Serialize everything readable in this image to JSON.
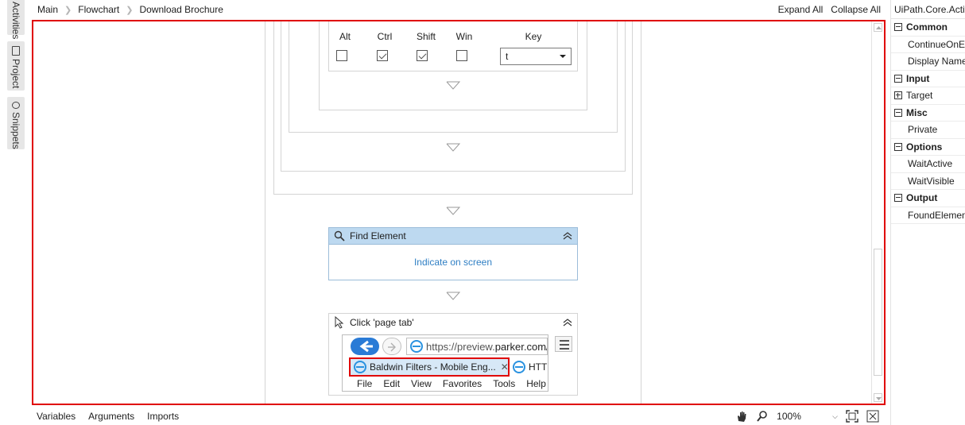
{
  "left_tabs": {
    "activities": "Activities",
    "project": "Project",
    "snippets": "Snippets"
  },
  "breadcrumb": [
    "Main",
    "Flowchart",
    "Download Brochure"
  ],
  "topbar": {
    "expand_all": "Expand All",
    "collapse_all": "Collapse All"
  },
  "modifiers": {
    "headers": [
      "Alt",
      "Ctrl",
      "Shift",
      "Win",
      "Key"
    ],
    "checked": [
      false,
      true,
      true,
      false
    ],
    "key_value": "t"
  },
  "find_element": {
    "title": "Find Element",
    "indicate": "Indicate on screen"
  },
  "click_activity": {
    "title": "Click 'page tab'",
    "browser": {
      "url_prefix": "https://preview.",
      "url_host": "parker.com/l",
      "active_tab": "Baldwin Filters - Mobile Eng...",
      "other_tab": "HTT",
      "menu": [
        "File",
        "Edit",
        "View",
        "Favorites",
        "Tools",
        "Help"
      ]
    }
  },
  "bottombar": {
    "tabs": [
      "Variables",
      "Arguments",
      "Imports"
    ],
    "zoom": "100%"
  },
  "properties": {
    "title": "UiPath.Core.Activities.FindElement",
    "rows": [
      {
        "kind": "cat",
        "label": "Common"
      },
      {
        "kind": "item",
        "label": "ContinueOnError"
      },
      {
        "kind": "item",
        "label": "Display Name"
      },
      {
        "kind": "cat",
        "label": "Input"
      },
      {
        "kind": "expand",
        "label": "Target"
      },
      {
        "kind": "cat",
        "label": "Misc"
      },
      {
        "kind": "item",
        "label": "Private"
      },
      {
        "kind": "cat",
        "label": "Options"
      },
      {
        "kind": "item",
        "label": "WaitActive"
      },
      {
        "kind": "item",
        "label": "WaitVisible"
      },
      {
        "kind": "cat",
        "label": "Output"
      },
      {
        "kind": "item",
        "label": "FoundElement"
      }
    ]
  },
  "colors": {
    "highlight_border": "#e00000",
    "activity_header": "#bdd9f0",
    "link": "#2f7fc4"
  }
}
